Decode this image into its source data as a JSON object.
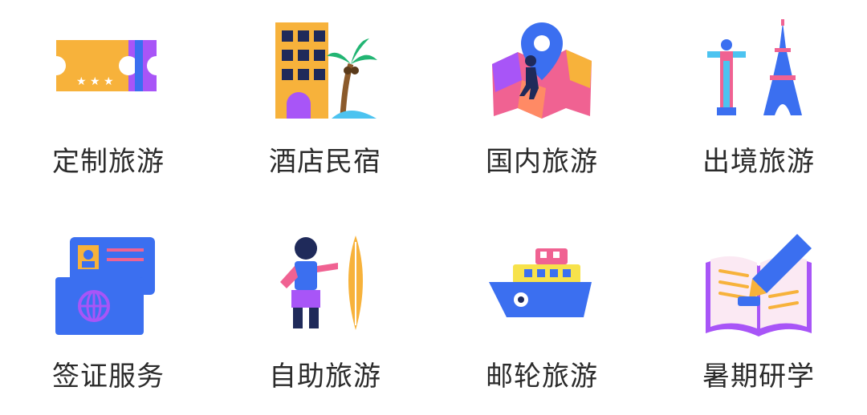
{
  "menu": {
    "items": [
      {
        "label": "定制旅游",
        "icon": "ticket-icon"
      },
      {
        "label": "酒店民宿",
        "icon": "hotel-palm-icon"
      },
      {
        "label": "国内旅游",
        "icon": "map-pin-icon"
      },
      {
        "label": "出境旅游",
        "icon": "landmarks-icon"
      },
      {
        "label": "签证服务",
        "icon": "passport-card-icon"
      },
      {
        "label": "自助旅游",
        "icon": "traveler-surfboard-icon"
      },
      {
        "label": "邮轮旅游",
        "icon": "cruise-ship-icon"
      },
      {
        "label": "暑期研学",
        "icon": "open-book-pen-icon"
      }
    ]
  },
  "colors": {
    "label": "#2b2b2b",
    "orange": "#f7b23b",
    "purple": "#a855f7",
    "blue": "#3b6ff0",
    "pink": "#f06292",
    "navy": "#1f2a5a"
  }
}
